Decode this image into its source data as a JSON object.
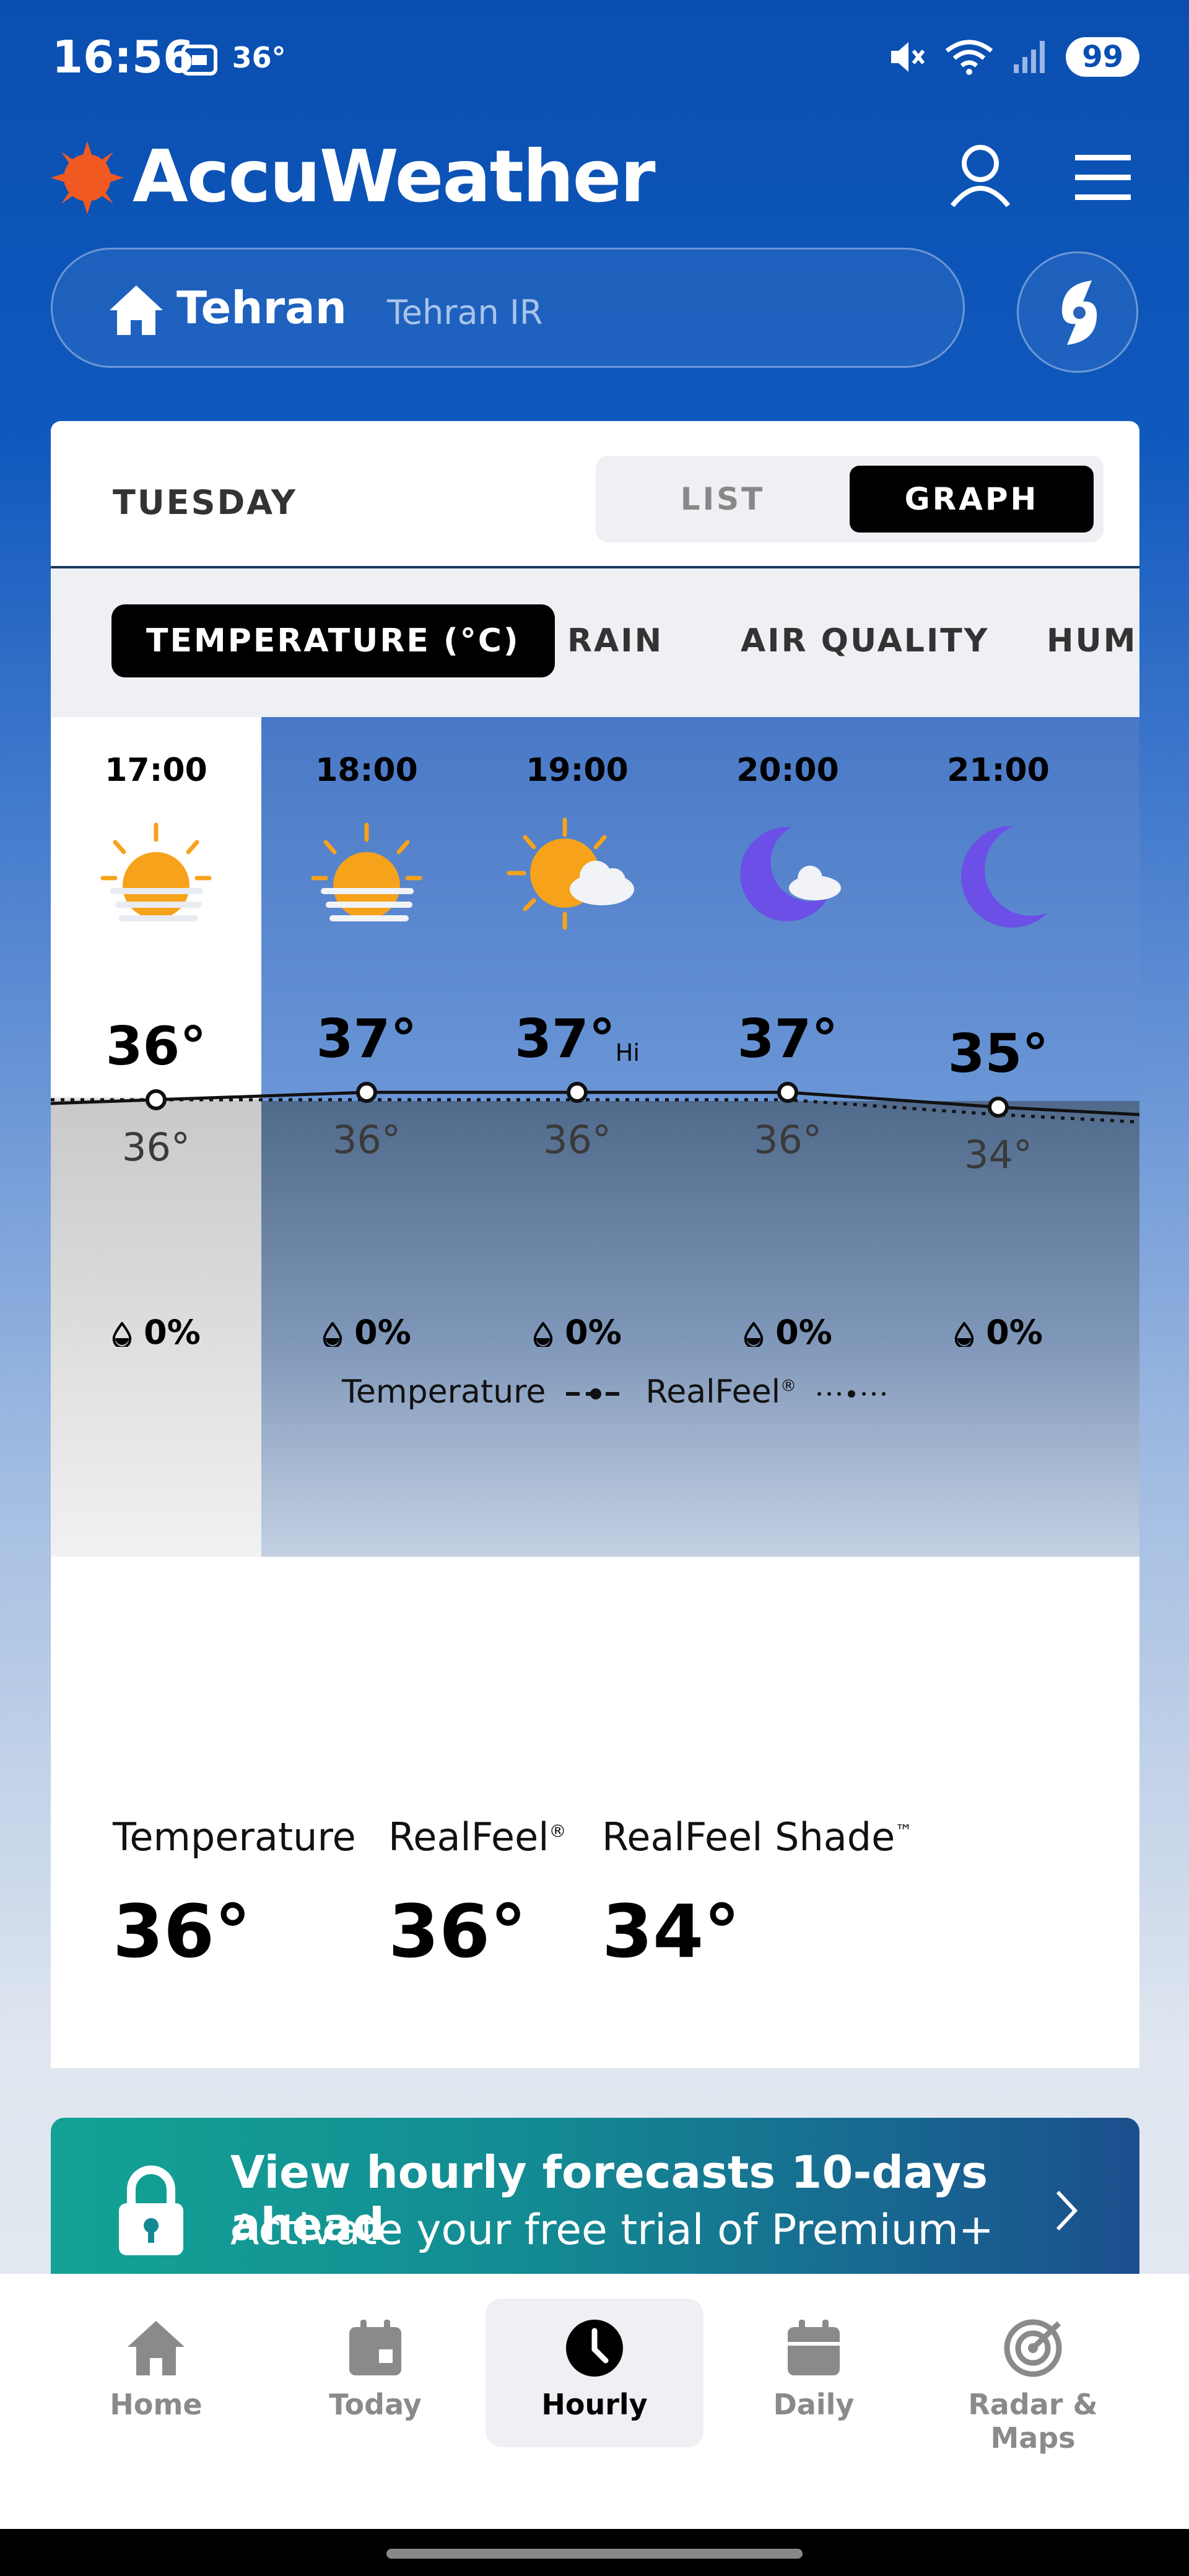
{
  "status_bar": {
    "time": "16:56",
    "screen_temp": "36°",
    "battery": "99"
  },
  "header": {
    "app_name": "AccuWeather",
    "brand_color": "#f05a22"
  },
  "location": {
    "city": "Tehran",
    "region": "Tehran IR"
  },
  "day_label": "TUESDAY",
  "view_toggle": {
    "list": "LIST",
    "graph": "GRAPH",
    "selected": "GRAPH"
  },
  "categories": [
    {
      "label": "TEMPERATURE (°C)",
      "active": true
    },
    {
      "label": "RAIN",
      "active": false
    },
    {
      "label": "AIR QUALITY",
      "active": false
    },
    {
      "label": "HUMI",
      "active": false
    }
  ],
  "hours": [
    {
      "time": "17:00",
      "icon": "sun-setting-icon",
      "temp": "36°",
      "hi": "",
      "realfeel": "36°",
      "precip": "0%",
      "selected": true
    },
    {
      "time": "18:00",
      "icon": "sun-setting-icon",
      "temp": "37°",
      "hi": "",
      "realfeel": "36°",
      "precip": "0%",
      "selected": false
    },
    {
      "time": "19:00",
      "icon": "sun-cloud-icon",
      "temp": "37°",
      "hi": "Hi",
      "realfeel": "36°",
      "precip": "0%",
      "selected": false
    },
    {
      "time": "20:00",
      "icon": "moon-cloud-icon",
      "temp": "37°",
      "hi": "",
      "realfeel": "36°",
      "precip": "0%",
      "selected": false
    },
    {
      "time": "21:00",
      "icon": "moon-icon",
      "temp": "35°",
      "hi": "",
      "realfeel": "34°",
      "precip": "0%",
      "selected": false
    }
  ],
  "chart_data": {
    "type": "line",
    "x": [
      "17:00",
      "18:00",
      "19:00",
      "20:00",
      "21:00"
    ],
    "series": [
      {
        "name": "Temperature",
        "values": [
          36,
          37,
          37,
          37,
          35
        ]
      },
      {
        "name": "RealFeel®",
        "values": [
          36,
          36,
          36,
          36,
          34
        ]
      }
    ]
  },
  "legend": {
    "temperature": "Temperature",
    "realfeel": "RealFeel"
  },
  "stats": {
    "temperature_label": "Temperature",
    "temperature_value": "36°",
    "realfeel_label": "RealFeel",
    "realfeel_value": "36°",
    "shade_label": "RealFeel Shade",
    "shade_value": "34°"
  },
  "promo": {
    "title": "View hourly forecasts 10-days ahead",
    "subtitle": "Activate your free trial of Premium+"
  },
  "nav": [
    {
      "label": "Home",
      "icon": "home-icon",
      "active": false
    },
    {
      "label": "Today",
      "icon": "calendar-today-icon",
      "active": false
    },
    {
      "label": "Hourly",
      "icon": "clock-icon",
      "active": true
    },
    {
      "label": "Daily",
      "icon": "calendar-daily-icon",
      "active": false
    },
    {
      "label": "Radar & Maps",
      "icon": "radar-icon",
      "active": false
    }
  ]
}
